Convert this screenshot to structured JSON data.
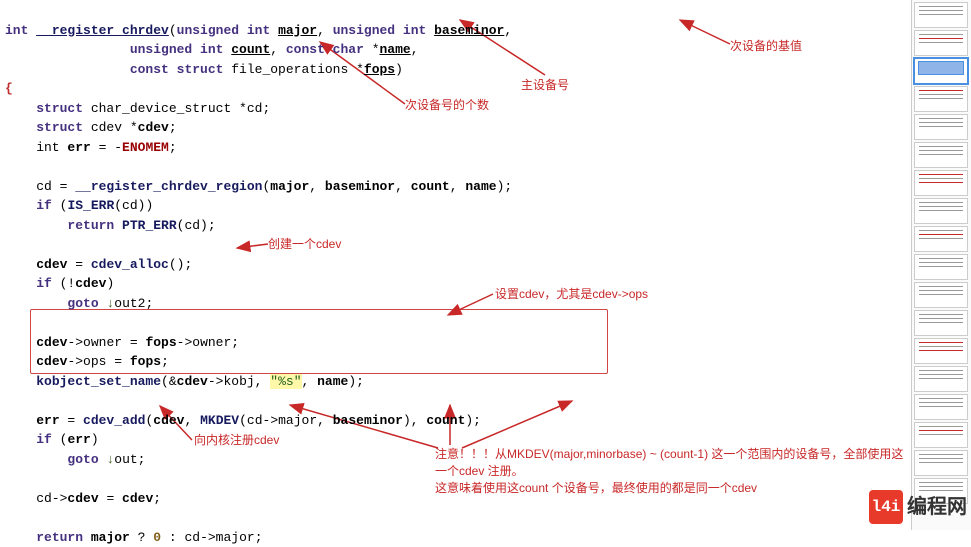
{
  "code": {
    "l1a": "int ",
    "l1b": "__register_chrdev",
    "l1c": "(",
    "l1d": "unsigned int ",
    "l1e": "major",
    "l1f": ", ",
    "l1g": "unsigned int ",
    "l1h": "baseminor",
    "l1i": ",",
    "l2a": "                ",
    "l2b": "unsigned int ",
    "l2c": "count",
    "l2d": ", ",
    "l2e": "const char",
    "l2f": " *",
    "l2g": "name",
    "l2h": ",",
    "l3a": "                ",
    "l3b": "const ",
    "l3c": "struct",
    "l3d": " file_operations *",
    "l3e": "fops",
    "l3f": ")",
    "l4": "{",
    "l5a": "    ",
    "l5b": "struct",
    "l5c": " char_device_struct *cd;",
    "l6a": "    ",
    "l6b": "struct",
    "l6c": " cdev *",
    "l6d": "cdev",
    "l6e": ";",
    "l7a": "    int ",
    "l7b": "err",
    "l7c": " = -",
    "l7d": "ENOMEM",
    "l7e": ";",
    "l8": "",
    "l9a": "    cd = ",
    "l9b": "__register_chrdev_region",
    "l9c": "(",
    "l9d": "major",
    "l9e": ", ",
    "l9f": "baseminor",
    "l9g": ", ",
    "l9h": "count",
    "l9i": ", ",
    "l9j": "name",
    "l9k": ");",
    "l10a": "    ",
    "l10b": "if",
    "l10c": " (",
    "l10d": "IS_ERR",
    "l10e": "(cd))",
    "l11a": "        ",
    "l11b": "return",
    "l11c": " ",
    "l11d": "PTR_ERR",
    "l11e": "(cd);",
    "l12": "",
    "l13a": "    ",
    "l13b": "cdev",
    "l13c": " = ",
    "l13d": "cdev_alloc",
    "l13e": "();",
    "l14a": "    ",
    "l14b": "if",
    "l14c": " (!",
    "l14d": "cdev",
    "l14e": ")",
    "l15a": "        ",
    "l15b": "goto",
    "l15c": " ",
    "l15d": "↓",
    "l15e": "out2;",
    "l16": "",
    "l17a": "    ",
    "l17b": "cdev",
    "l17c": "->owner = ",
    "l17d": "fops",
    "l17e": "->owner;",
    "l18a": "    ",
    "l18b": "cdev",
    "l18c": "->ops = ",
    "l18d": "fops",
    "l18e": ";",
    "l19a": "    ",
    "l19b": "kobject_set_name",
    "l19c": "(&",
    "l19d": "cdev",
    "l19e": "->kobj, ",
    "l19f": "\"%s\"",
    "l19g": ", ",
    "l19h": "name",
    "l19i": ");",
    "l20": "",
    "l21a": "    ",
    "l21b": "err",
    "l21c": " = ",
    "l21d": "cdev_add",
    "l21e": "(",
    "l21f": "cdev",
    "l21g": ", ",
    "l21h": "MKDEV",
    "l21i": "(cd->major, ",
    "l21j": "baseminor",
    "l21k": "), ",
    "l21l": "count",
    "l21m": ");",
    "l22a": "    ",
    "l22b": "if",
    "l22c": " (",
    "l22d": "err",
    "l22e": ")",
    "l23a": "        ",
    "l23b": "goto",
    "l23c": " ",
    "l23d": "↓",
    "l23e": "out;",
    "l24": "",
    "l25a": "    cd->",
    "l25b": "cdev",
    "l25c": " = ",
    "l25d": "cdev",
    "l25e": ";",
    "l26": "",
    "l27a": "    ",
    "l27b": "return",
    "l27c": " ",
    "l27d": "major",
    "l27e": " ? ",
    "l27f": "0",
    "l27g": " : cd->major;"
  },
  "annotations": {
    "a1": "主设备号",
    "a2": "次设备的基值",
    "a3": "次设备号的个数",
    "a4": "创建一个cdev",
    "a5": "设置cdev，尤其是cdev->ops",
    "a6": "向内核注册cdev",
    "a7": "注意！！！从MKDEV(major,minorbase) ~ (count-1) 这一个范围内的设备号，全部使用这一个cdev 注册。\n这意味着使用这count 个设备号，最终使用的都是同一个cdev"
  },
  "watermark": {
    "logo": "l4i",
    "text": "编程网"
  }
}
